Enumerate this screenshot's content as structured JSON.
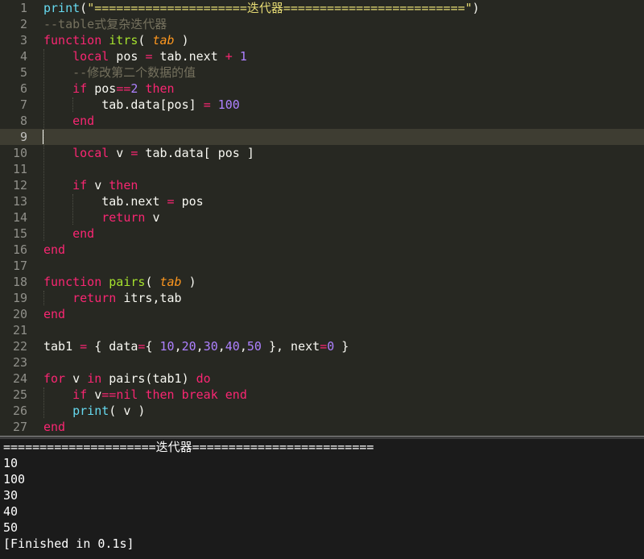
{
  "editor": {
    "current_line": 9,
    "lines": [
      {
        "n": "1",
        "tokens": [
          [
            "fn",
            "print"
          ],
          [
            "txt",
            "("
          ],
          [
            "str",
            "\"=====================迭代器=========================\""
          ],
          [
            "txt",
            ")"
          ]
        ]
      },
      {
        "n": "2",
        "tokens": [
          [
            "cm",
            "--table式复杂迭代器"
          ]
        ]
      },
      {
        "n": "3",
        "tokens": [
          [
            "kw",
            "function "
          ],
          [
            "name",
            "itrs"
          ],
          [
            "txt",
            "( "
          ],
          [
            "param",
            "tab"
          ],
          [
            "txt",
            " )"
          ]
        ]
      },
      {
        "n": "4",
        "tokens": [
          [
            "txt",
            "    "
          ],
          [
            "kw",
            "local"
          ],
          [
            "txt",
            " pos "
          ],
          [
            "op",
            "="
          ],
          [
            "txt",
            " tab.next "
          ],
          [
            "op",
            "+"
          ],
          [
            "txt",
            " "
          ],
          [
            "num",
            "1"
          ]
        ]
      },
      {
        "n": "5",
        "tokens": [
          [
            "txt",
            "    "
          ],
          [
            "cm",
            "--修改第二个数据的值"
          ]
        ]
      },
      {
        "n": "6",
        "tokens": [
          [
            "txt",
            "    "
          ],
          [
            "kw",
            "if"
          ],
          [
            "txt",
            " pos"
          ],
          [
            "op",
            "=="
          ],
          [
            "num",
            "2"
          ],
          [
            "txt",
            " "
          ],
          [
            "kw",
            "then"
          ]
        ]
      },
      {
        "n": "7",
        "tokens": [
          [
            "txt",
            "        tab.data[pos] "
          ],
          [
            "op",
            "="
          ],
          [
            "txt",
            " "
          ],
          [
            "num",
            "100"
          ]
        ]
      },
      {
        "n": "8",
        "tokens": [
          [
            "txt",
            "    "
          ],
          [
            "kw",
            "end"
          ]
        ]
      },
      {
        "n": "9",
        "tokens": []
      },
      {
        "n": "10",
        "tokens": [
          [
            "txt",
            "    "
          ],
          [
            "kw",
            "local"
          ],
          [
            "txt",
            " v "
          ],
          [
            "op",
            "="
          ],
          [
            "txt",
            " tab.data[ pos ]"
          ]
        ]
      },
      {
        "n": "11",
        "tokens": []
      },
      {
        "n": "12",
        "tokens": [
          [
            "txt",
            "    "
          ],
          [
            "kw",
            "if"
          ],
          [
            "txt",
            " v "
          ],
          [
            "kw",
            "then"
          ]
        ]
      },
      {
        "n": "13",
        "tokens": [
          [
            "txt",
            "        tab.next "
          ],
          [
            "op",
            "="
          ],
          [
            "txt",
            " pos"
          ]
        ]
      },
      {
        "n": "14",
        "tokens": [
          [
            "txt",
            "        "
          ],
          [
            "kw",
            "return"
          ],
          [
            "txt",
            " v"
          ]
        ]
      },
      {
        "n": "15",
        "tokens": [
          [
            "txt",
            "    "
          ],
          [
            "kw",
            "end"
          ]
        ]
      },
      {
        "n": "16",
        "tokens": [
          [
            "kw",
            "end"
          ]
        ]
      },
      {
        "n": "17",
        "tokens": []
      },
      {
        "n": "18",
        "tokens": [
          [
            "kw",
            "function "
          ],
          [
            "name",
            "pairs"
          ],
          [
            "txt",
            "( "
          ],
          [
            "param",
            "tab"
          ],
          [
            "txt",
            " )"
          ]
        ]
      },
      {
        "n": "19",
        "tokens": [
          [
            "txt",
            "    "
          ],
          [
            "kw",
            "return"
          ],
          [
            "txt",
            " itrs,tab"
          ]
        ]
      },
      {
        "n": "20",
        "tokens": [
          [
            "kw",
            "end"
          ]
        ]
      },
      {
        "n": "21",
        "tokens": []
      },
      {
        "n": "22",
        "tokens": [
          [
            "txt",
            "tab1 "
          ],
          [
            "op",
            "="
          ],
          [
            "txt",
            " { data"
          ],
          [
            "op",
            "="
          ],
          [
            "txt",
            "{ "
          ],
          [
            "num",
            "10"
          ],
          [
            "txt",
            ","
          ],
          [
            "num",
            "20"
          ],
          [
            "txt",
            ","
          ],
          [
            "num",
            "30"
          ],
          [
            "txt",
            ","
          ],
          [
            "num",
            "40"
          ],
          [
            "txt",
            ","
          ],
          [
            "num",
            "50"
          ],
          [
            "txt",
            " }, next"
          ],
          [
            "op",
            "="
          ],
          [
            "num",
            "0"
          ],
          [
            "txt",
            " }"
          ]
        ]
      },
      {
        "n": "23",
        "tokens": []
      },
      {
        "n": "24",
        "tokens": [
          [
            "kw",
            "for"
          ],
          [
            "txt",
            " v "
          ],
          [
            "kw",
            "in"
          ],
          [
            "txt",
            " pairs(tab1) "
          ],
          [
            "kw",
            "do"
          ]
        ]
      },
      {
        "n": "25",
        "tokens": [
          [
            "txt",
            "    "
          ],
          [
            "kw",
            "if"
          ],
          [
            "txt",
            " v"
          ],
          [
            "op",
            "=="
          ],
          [
            "kw",
            "nil"
          ],
          [
            "txt",
            " "
          ],
          [
            "kw",
            "then"
          ],
          [
            "txt",
            " "
          ],
          [
            "kw",
            "break"
          ],
          [
            "txt",
            " "
          ],
          [
            "kw",
            "end"
          ]
        ]
      },
      {
        "n": "26",
        "tokens": [
          [
            "txt",
            "    "
          ],
          [
            "fn",
            "print"
          ],
          [
            "txt",
            "( v )"
          ]
        ]
      },
      {
        "n": "27",
        "tokens": [
          [
            "kw",
            "end"
          ]
        ]
      }
    ]
  },
  "output": {
    "lines": [
      "=====================迭代器=========================",
      "10",
      "100",
      "30",
      "40",
      "50",
      "[Finished in 0.1s]"
    ]
  }
}
